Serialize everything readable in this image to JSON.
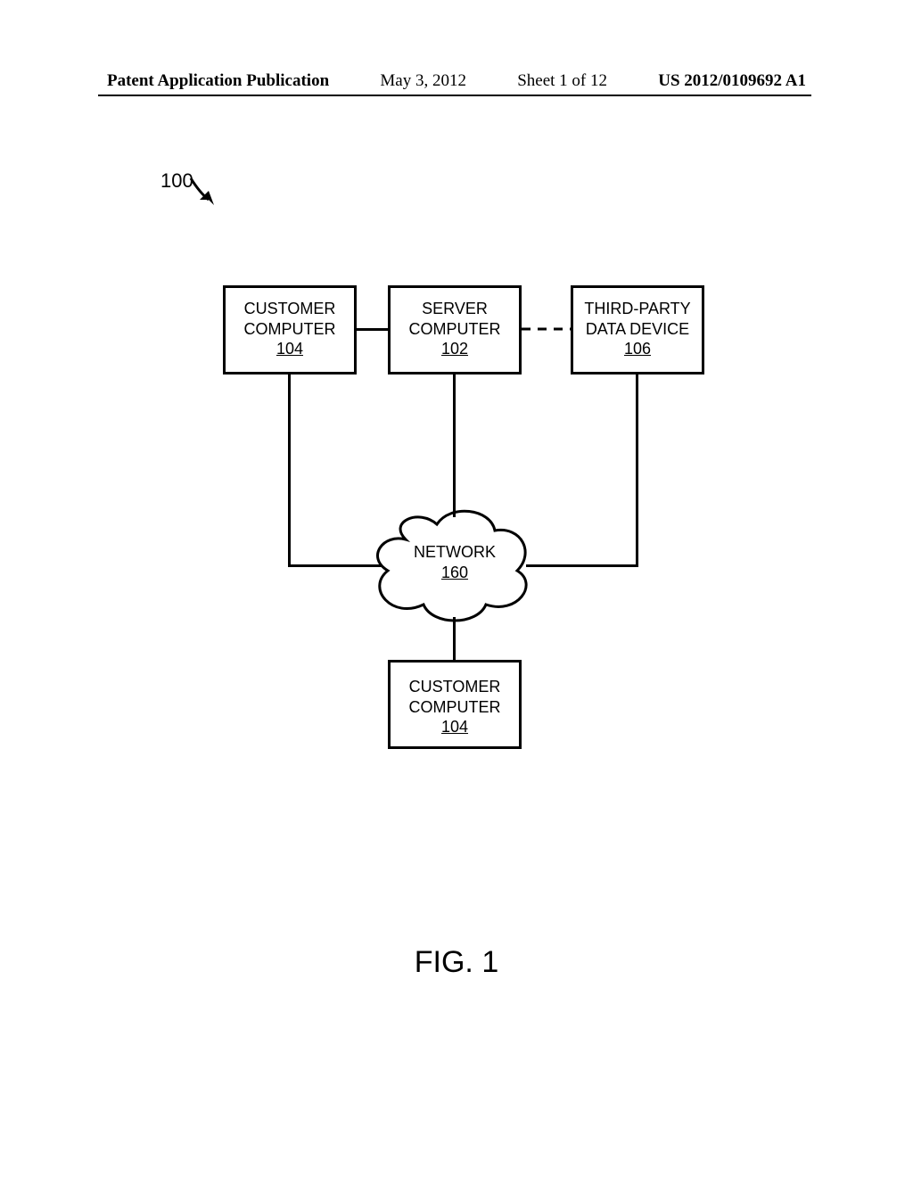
{
  "header": {
    "left": "Patent Application Publication",
    "date": "May 3, 2012",
    "sheet": "Sheet 1 of 12",
    "pubno": "US 2012/0109692 A1"
  },
  "ref100": "100",
  "boxes": {
    "customer_top": {
      "line1": "CUSTOMER",
      "line2": "COMPUTER",
      "ref": "104"
    },
    "server": {
      "line1": "SERVER",
      "line2": "COMPUTER",
      "ref": "102"
    },
    "third": {
      "line1": "THIRD-PARTY",
      "line2": "DATA DEVICE",
      "ref": "106"
    },
    "customer_bot": {
      "line1": "CUSTOMER",
      "line2": "COMPUTER",
      "ref": "104"
    }
  },
  "cloud": {
    "label": "NETWORK",
    "ref": "160"
  },
  "figure_caption": "FIG. 1"
}
